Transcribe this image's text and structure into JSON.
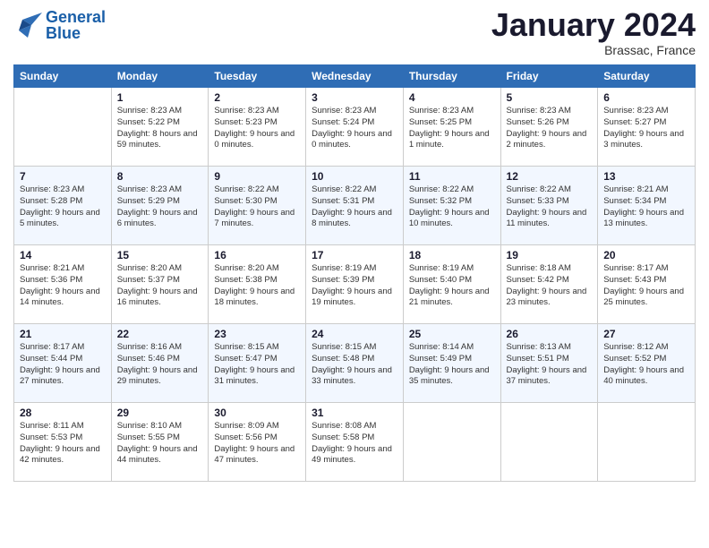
{
  "logo": {
    "line1": "General",
    "line2": "Blue"
  },
  "title": "January 2024",
  "location": "Brassac, France",
  "days_of_week": [
    "Sunday",
    "Monday",
    "Tuesday",
    "Wednesday",
    "Thursday",
    "Friday",
    "Saturday"
  ],
  "weeks": [
    [
      {
        "day": "",
        "sunrise": "",
        "sunset": "",
        "daylight": ""
      },
      {
        "day": "1",
        "sunrise": "Sunrise: 8:23 AM",
        "sunset": "Sunset: 5:22 PM",
        "daylight": "Daylight: 8 hours and 59 minutes."
      },
      {
        "day": "2",
        "sunrise": "Sunrise: 8:23 AM",
        "sunset": "Sunset: 5:23 PM",
        "daylight": "Daylight: 9 hours and 0 minutes."
      },
      {
        "day": "3",
        "sunrise": "Sunrise: 8:23 AM",
        "sunset": "Sunset: 5:24 PM",
        "daylight": "Daylight: 9 hours and 0 minutes."
      },
      {
        "day": "4",
        "sunrise": "Sunrise: 8:23 AM",
        "sunset": "Sunset: 5:25 PM",
        "daylight": "Daylight: 9 hours and 1 minute."
      },
      {
        "day": "5",
        "sunrise": "Sunrise: 8:23 AM",
        "sunset": "Sunset: 5:26 PM",
        "daylight": "Daylight: 9 hours and 2 minutes."
      },
      {
        "day": "6",
        "sunrise": "Sunrise: 8:23 AM",
        "sunset": "Sunset: 5:27 PM",
        "daylight": "Daylight: 9 hours and 3 minutes."
      }
    ],
    [
      {
        "day": "7",
        "sunrise": "Sunrise: 8:23 AM",
        "sunset": "Sunset: 5:28 PM",
        "daylight": "Daylight: 9 hours and 5 minutes."
      },
      {
        "day": "8",
        "sunrise": "Sunrise: 8:23 AM",
        "sunset": "Sunset: 5:29 PM",
        "daylight": "Daylight: 9 hours and 6 minutes."
      },
      {
        "day": "9",
        "sunrise": "Sunrise: 8:22 AM",
        "sunset": "Sunset: 5:30 PM",
        "daylight": "Daylight: 9 hours and 7 minutes."
      },
      {
        "day": "10",
        "sunrise": "Sunrise: 8:22 AM",
        "sunset": "Sunset: 5:31 PM",
        "daylight": "Daylight: 9 hours and 8 minutes."
      },
      {
        "day": "11",
        "sunrise": "Sunrise: 8:22 AM",
        "sunset": "Sunset: 5:32 PM",
        "daylight": "Daylight: 9 hours and 10 minutes."
      },
      {
        "day": "12",
        "sunrise": "Sunrise: 8:22 AM",
        "sunset": "Sunset: 5:33 PM",
        "daylight": "Daylight: 9 hours and 11 minutes."
      },
      {
        "day": "13",
        "sunrise": "Sunrise: 8:21 AM",
        "sunset": "Sunset: 5:34 PM",
        "daylight": "Daylight: 9 hours and 13 minutes."
      }
    ],
    [
      {
        "day": "14",
        "sunrise": "Sunrise: 8:21 AM",
        "sunset": "Sunset: 5:36 PM",
        "daylight": "Daylight: 9 hours and 14 minutes."
      },
      {
        "day": "15",
        "sunrise": "Sunrise: 8:20 AM",
        "sunset": "Sunset: 5:37 PM",
        "daylight": "Daylight: 9 hours and 16 minutes."
      },
      {
        "day": "16",
        "sunrise": "Sunrise: 8:20 AM",
        "sunset": "Sunset: 5:38 PM",
        "daylight": "Daylight: 9 hours and 18 minutes."
      },
      {
        "day": "17",
        "sunrise": "Sunrise: 8:19 AM",
        "sunset": "Sunset: 5:39 PM",
        "daylight": "Daylight: 9 hours and 19 minutes."
      },
      {
        "day": "18",
        "sunrise": "Sunrise: 8:19 AM",
        "sunset": "Sunset: 5:40 PM",
        "daylight": "Daylight: 9 hours and 21 minutes."
      },
      {
        "day": "19",
        "sunrise": "Sunrise: 8:18 AM",
        "sunset": "Sunset: 5:42 PM",
        "daylight": "Daylight: 9 hours and 23 minutes."
      },
      {
        "day": "20",
        "sunrise": "Sunrise: 8:17 AM",
        "sunset": "Sunset: 5:43 PM",
        "daylight": "Daylight: 9 hours and 25 minutes."
      }
    ],
    [
      {
        "day": "21",
        "sunrise": "Sunrise: 8:17 AM",
        "sunset": "Sunset: 5:44 PM",
        "daylight": "Daylight: 9 hours and 27 minutes."
      },
      {
        "day": "22",
        "sunrise": "Sunrise: 8:16 AM",
        "sunset": "Sunset: 5:46 PM",
        "daylight": "Daylight: 9 hours and 29 minutes."
      },
      {
        "day": "23",
        "sunrise": "Sunrise: 8:15 AM",
        "sunset": "Sunset: 5:47 PM",
        "daylight": "Daylight: 9 hours and 31 minutes."
      },
      {
        "day": "24",
        "sunrise": "Sunrise: 8:15 AM",
        "sunset": "Sunset: 5:48 PM",
        "daylight": "Daylight: 9 hours and 33 minutes."
      },
      {
        "day": "25",
        "sunrise": "Sunrise: 8:14 AM",
        "sunset": "Sunset: 5:49 PM",
        "daylight": "Daylight: 9 hours and 35 minutes."
      },
      {
        "day": "26",
        "sunrise": "Sunrise: 8:13 AM",
        "sunset": "Sunset: 5:51 PM",
        "daylight": "Daylight: 9 hours and 37 minutes."
      },
      {
        "day": "27",
        "sunrise": "Sunrise: 8:12 AM",
        "sunset": "Sunset: 5:52 PM",
        "daylight": "Daylight: 9 hours and 40 minutes."
      }
    ],
    [
      {
        "day": "28",
        "sunrise": "Sunrise: 8:11 AM",
        "sunset": "Sunset: 5:53 PM",
        "daylight": "Daylight: 9 hours and 42 minutes."
      },
      {
        "day": "29",
        "sunrise": "Sunrise: 8:10 AM",
        "sunset": "Sunset: 5:55 PM",
        "daylight": "Daylight: 9 hours and 44 minutes."
      },
      {
        "day": "30",
        "sunrise": "Sunrise: 8:09 AM",
        "sunset": "Sunset: 5:56 PM",
        "daylight": "Daylight: 9 hours and 47 minutes."
      },
      {
        "day": "31",
        "sunrise": "Sunrise: 8:08 AM",
        "sunset": "Sunset: 5:58 PM",
        "daylight": "Daylight: 9 hours and 49 minutes."
      },
      {
        "day": "",
        "sunrise": "",
        "sunset": "",
        "daylight": ""
      },
      {
        "day": "",
        "sunrise": "",
        "sunset": "",
        "daylight": ""
      },
      {
        "day": "",
        "sunrise": "",
        "sunset": "",
        "daylight": ""
      }
    ]
  ]
}
